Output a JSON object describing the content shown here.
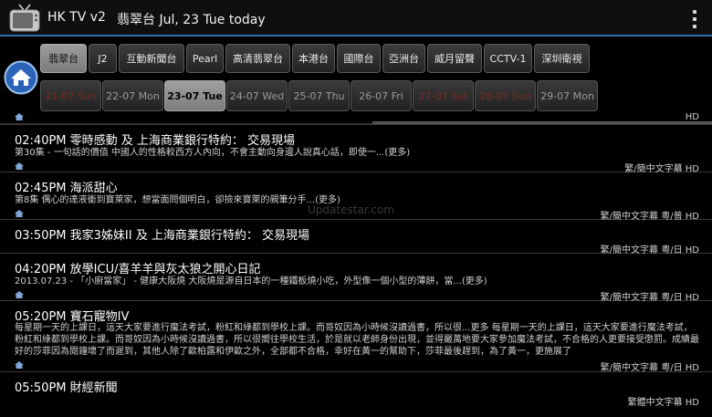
{
  "app": {
    "title": "HK TV v2",
    "subtitle": "翡翠台  Jul, 23  Tue  today"
  },
  "channels": [
    "翡翠台",
    "J2",
    "互動新聞台",
    "Pearl",
    "高清翡翠台",
    "本港台",
    "國際台",
    "亞洲台",
    "威月留聲",
    "CCTV-1",
    "深圳衛視"
  ],
  "selected_channel": "翡翠台",
  "dates": [
    "21-07 Sun",
    "22-07 Mon",
    "23-07 Tue",
    "24-07 Wed",
    "25-07 Thu",
    "26-07 Fri",
    "27-07 Sat",
    "28-07 Sun",
    "29-07 Mon"
  ],
  "selected_date": "23-07 Tue",
  "list_top_meta": "HD",
  "programs": [
    {
      "title": "02:40PM 零時感動 及 上海商業銀行特約： 交易現場",
      "desc": "第30集 - 一句話的價值 中國人的性格較西方人內向，不會主動向身邊人說真心話，即使一...(更多)",
      "meta": "繁/簡中文字幕  HD"
    },
    {
      "title": "02:45PM 海派甜心",
      "desc": "第8集 偶心的達液衝到寶萊家，想當面問個明白，卻撿來寶萊的親筆分手...(更多)",
      "meta": "繁/簡中文字幕  粵/普  HD"
    },
    {
      "title": "03:50PM 我家3姊妹II 及 上海商業銀行特約： 交易現場",
      "desc": "",
      "meta": "繁/簡中文字幕  粵/日  HD"
    },
    {
      "title": "04:20PM 放學ICU/喜羊羊與灰太狼之開心日記",
      "desc": "2013.07.23 - 「小廚當家」 - 健康大阪燒 大阪燒是源自日本的一種鐵板燒小吃，外型像一個小型的薄餅，當...(更多)",
      "meta": "繁/簡中文字幕  粵/日  HD"
    },
    {
      "title": "05:20PM 寶石寵物IV",
      "desc": "每星期一天的上課日，這天大家要進行魔法考試，粉紅和綠都到學校上課。而哥奴因為小時候沒讀過書，所以很...更多 每星期一天的上課日，這天大家要進行魔法考試，粉紅和綠都到學校上課。而哥奴因為小時候沒讀過書，所以很嚮往學校生活，於是就以老師身份出現，並得嚴萬地要大家參加魔法考試，不合格的人更要接受懲罰。成績最好的莎菲因為閱鐘壞了而遲到，其他人除了歐柏露和伊歐之外，全部都不合格，幸好在黃一的幫助下，莎菲最後趕到，為了黃一，更施展了",
      "meta": "繁/簡中文字幕  粵/日  HD"
    },
    {
      "title": "05:50PM 財經新聞",
      "desc": "",
      "meta": "繁體中文字幕  HD"
    }
  ],
  "watermark": "Updatestar.com",
  "colors": {
    "accent": "#2f6fa5",
    "home_blue": "#2a63b8"
  }
}
